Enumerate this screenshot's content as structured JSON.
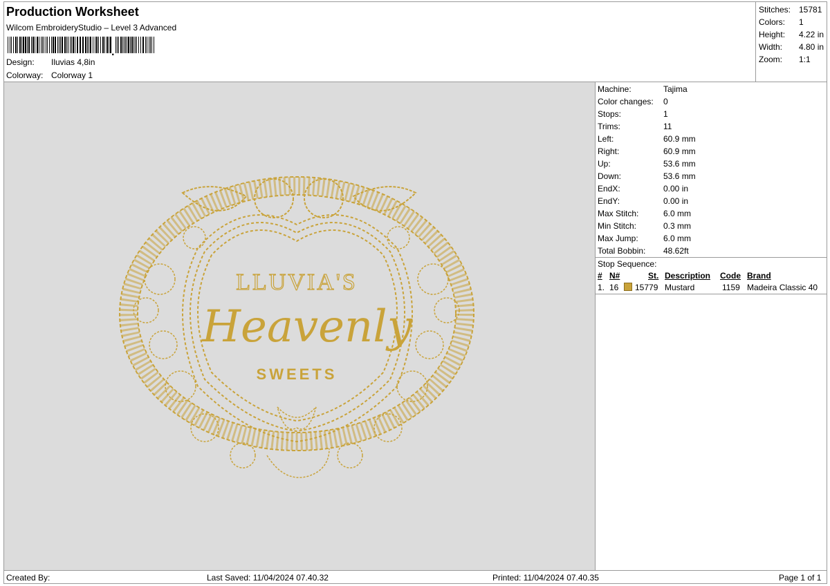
{
  "header": {
    "title": "Production Worksheet",
    "subtitle": "Wilcom EmbroideryStudio – Level 3 Advanced",
    "design_label": "Design:",
    "design_value": "Iluvias 4,8in",
    "colorway_label": "Colorway:",
    "colorway_value": "Colorway 1"
  },
  "stats": [
    {
      "label": "Stitches:",
      "value": "15781"
    },
    {
      "label": "Colors:",
      "value": "1"
    },
    {
      "label": "Height:",
      "value": "4.22 in"
    },
    {
      "label": "Width:",
      "value": "4.80 in"
    },
    {
      "label": "Zoom:",
      "value": "1:1"
    }
  ],
  "design": {
    "line1": "LLUVIA'S",
    "line2": "Heavenly",
    "line3": "SWEETS",
    "thread_color": "#c9a33a"
  },
  "machine": [
    {
      "label": "Machine:",
      "value": "Tajima"
    },
    {
      "label": "Color changes:",
      "value": "0"
    },
    {
      "label": "Stops:",
      "value": "1"
    },
    {
      "label": "Trims:",
      "value": "11"
    },
    {
      "label": "Left:",
      "value": "60.9 mm"
    },
    {
      "label": "Right:",
      "value": "60.9 mm"
    },
    {
      "label": "Up:",
      "value": "53.6 mm"
    },
    {
      "label": "Down:",
      "value": "53.6 mm"
    },
    {
      "label": "EndX:",
      "value": "0.00 in"
    },
    {
      "label": "EndY:",
      "value": "0.00 in"
    },
    {
      "label": "Max Stitch:",
      "value": "6.0 mm"
    },
    {
      "label": "Min Stitch:",
      "value": "0.3 mm"
    },
    {
      "label": "Max Jump:",
      "value": "6.0 mm"
    },
    {
      "label": "Total Bobbin:",
      "value": "48.62ft"
    }
  ],
  "stop_sequence": {
    "title": "Stop Sequence:",
    "columns": [
      "#",
      "N#",
      "St.",
      "Description",
      "Code",
      "Brand"
    ],
    "rows": [
      {
        "index": "1.",
        "n": "16",
        "stitches": "15779",
        "description": "Mustard",
        "code": "1159",
        "brand": "Madeira Classic 40",
        "color": "#c9a33a"
      }
    ]
  },
  "footer": {
    "created_by": "Created By:",
    "last_saved": "Last Saved: 11/04/2024 07.40.32",
    "printed": "Printed: 11/04/2024 07.40.35",
    "page": "Page 1 of 1"
  }
}
